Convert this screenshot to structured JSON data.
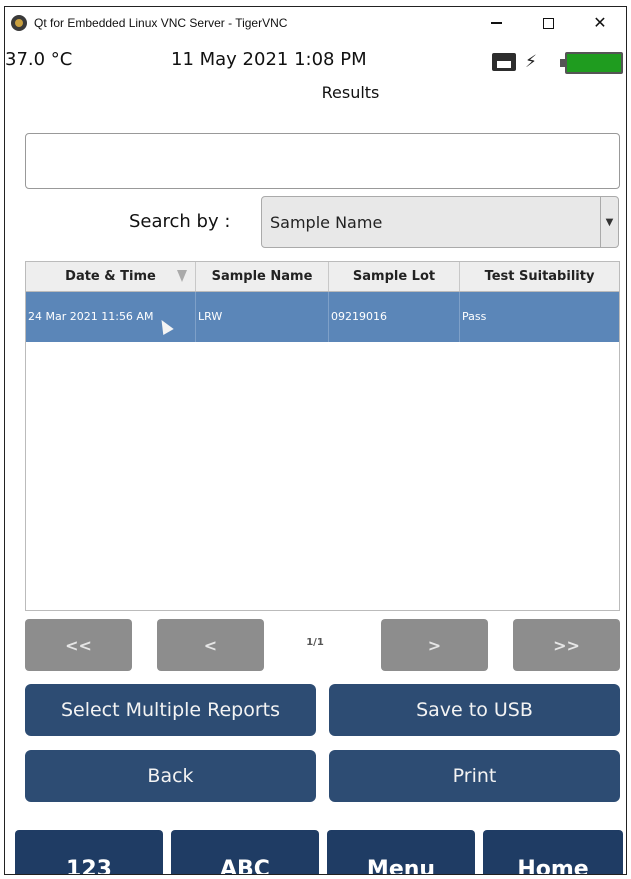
{
  "window": {
    "title": "Qt for Embedded Linux VNC Server - TigerVNC",
    "minimize_icon": "minimize-icon",
    "maximize_icon": "maximize-icon",
    "close_glyph": "✕"
  },
  "status": {
    "temperature": "37.0 °C",
    "datetime": "11 May 2021 1:08 PM",
    "screen_title": "Results",
    "icons": [
      "printer-icon",
      "plug-icon",
      "battery-icon"
    ],
    "battery_color": "#1f9c1f"
  },
  "search": {
    "value": "",
    "label": "Search by :",
    "selected": "Sample Name"
  },
  "table": {
    "columns": [
      "Date & Time",
      "Sample Name",
      "Sample Lot",
      "Test Suitability"
    ],
    "rows": [
      [
        "24 Mar 2021 11:56 AM",
        "LRW",
        "09219016",
        "Pass"
      ]
    ],
    "selected_row_color": "#5b86b8"
  },
  "pagination": {
    "first": "<<",
    "prev": "<",
    "page": "1/1",
    "next": ">",
    "last": ">>"
  },
  "actions": {
    "select_multiple": "Select Multiple Reports",
    "save_usb": "Save to USB",
    "back": "Back",
    "print": "Print"
  },
  "nav": {
    "numeric": "123",
    "alpha": "ABC",
    "menu": "Menu",
    "home": "Home"
  },
  "colors": {
    "action_button": "#2d4c73",
    "nav_button": "#1f3c64",
    "pagination_button": "#8d8d8d"
  }
}
